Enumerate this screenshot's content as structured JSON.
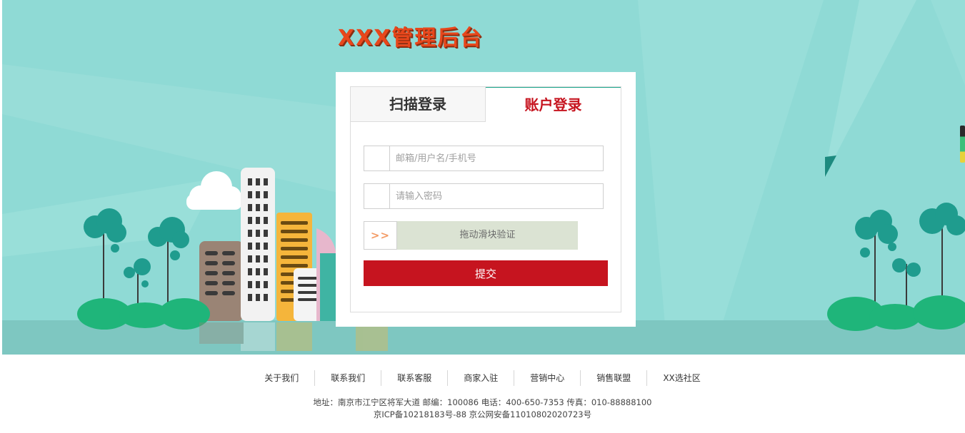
{
  "header": {
    "brand_title": "XXX管理后台"
  },
  "login": {
    "tabs": [
      {
        "label": "扫描登录",
        "active": false
      },
      {
        "label": "账户登录",
        "active": true
      }
    ],
    "username": {
      "placeholder": "邮箱/用户名/手机号",
      "value": ""
    },
    "password": {
      "placeholder": "请输入密码",
      "value": ""
    },
    "slider": {
      "handle_label": ">>",
      "text": "拖动滑块验证"
    },
    "submit_label": "提交"
  },
  "footer": {
    "links": [
      "关于我们",
      "联系我们",
      "联系客服",
      "商家入驻",
      "营销中心",
      "销售联盟",
      "XX选社区"
    ],
    "address": "地址：南京市江宁区将军大道 邮编：100086 电话：400-650-7353 传真：010-88888100",
    "icp": "京ICP备10218183号-88 京公网安备11010802020723号"
  },
  "colors": {
    "background_teal": "#8fdad5",
    "brand_orange": "#e8471c",
    "accent_red": "#c6141f",
    "tab_border_green": "#1aa58a",
    "slider_bg": "#dbe3d3"
  }
}
